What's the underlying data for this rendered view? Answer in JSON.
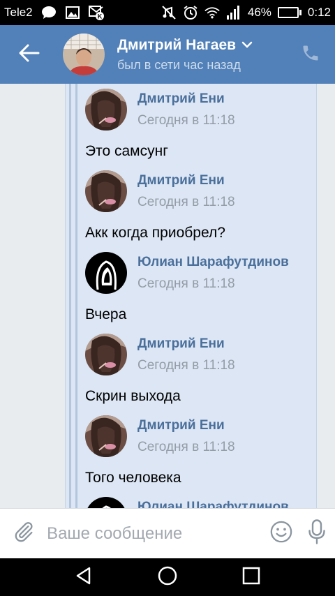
{
  "status_bar": {
    "carrier": "Tele2",
    "battery_percent": "46%",
    "battery_level": 0.46,
    "time": "0:12",
    "icons": [
      "chat-bubble-icon",
      "image-icon",
      "vk-notification-icon",
      "mute-icon",
      "alarm-icon",
      "wifi-icon",
      "signal-icon",
      "battery-icon"
    ]
  },
  "header": {
    "name": "Дмитрий Нагаев",
    "status": "был в сети час назад",
    "icons": [
      "back-arrow-icon",
      "chevron-down-icon",
      "phone-icon"
    ]
  },
  "messages": [
    {
      "author": "Дмитрий Ени",
      "time": "Сегодня в 11:18",
      "text": "Это самсунг",
      "avatar": "photo-avatar"
    },
    {
      "author": "Дмитрий Ени",
      "time": "Сегодня в 11:18",
      "text": "Акк когда приобрел?",
      "avatar": "photo-avatar"
    },
    {
      "author": "Юлиан Шарафутдинов",
      "time": "Сегодня в 11:18",
      "text": "Вчера",
      "avatar": "hooded-avatar"
    },
    {
      "author": "Дмитрий Ени",
      "time": "Сегодня в 11:18",
      "text": "Скрин выхода",
      "avatar": "photo-avatar"
    },
    {
      "author": "Дмитрий Ени",
      "time": "Сегодня в 11:18",
      "text": "Того человека",
      "avatar": "photo-avatar"
    },
    {
      "author": "Юлиан Шарафутдинов",
      "time": "",
      "text": "",
      "avatar": "hooded-avatar"
    }
  ],
  "input": {
    "placeholder": "Ваше сообщение",
    "value": "",
    "icons": [
      "paperclip-icon",
      "emoji-icon",
      "microphone-icon"
    ]
  },
  "nav": {
    "icons": [
      "back-triangle-icon",
      "home-circle-icon",
      "recents-square-icon"
    ]
  },
  "colors": {
    "toolbar": "#5181b8",
    "forward_panel": "#dce6f4",
    "author_name": "#4a6f9b",
    "timestamp": "#939ca7"
  }
}
